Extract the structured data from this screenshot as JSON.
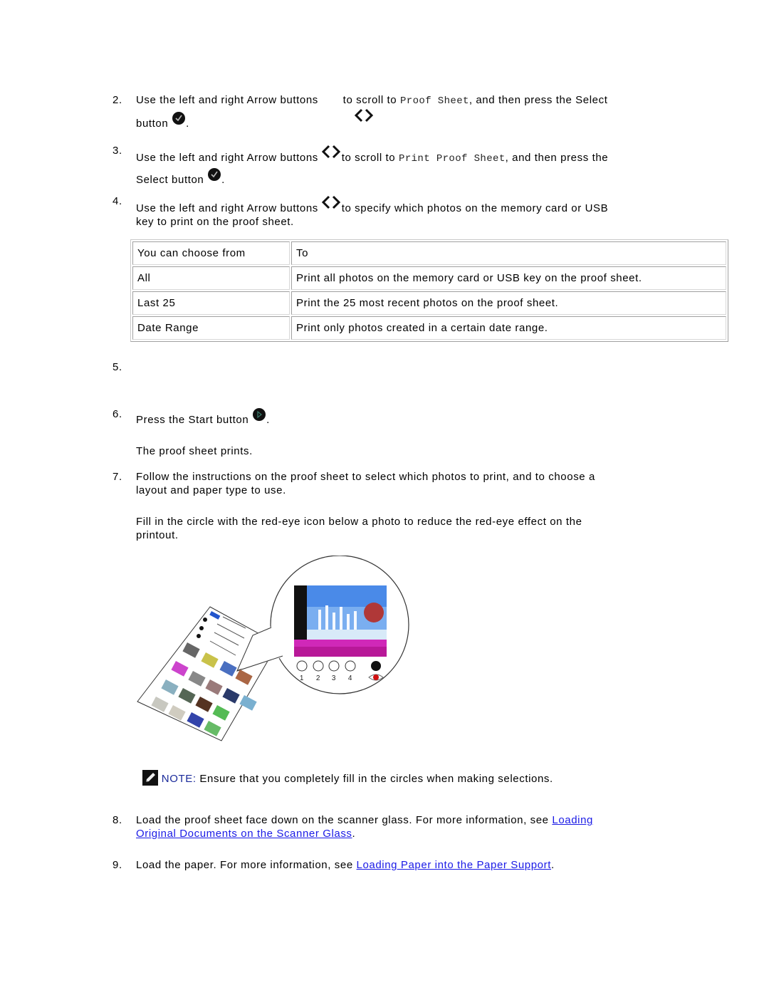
{
  "steps": [
    {
      "num": "2.",
      "pre": "Use the left and right Arrow buttons",
      "mid": " to scroll to ",
      "code": "Proof Sheet",
      "post": ", and then press the Select",
      "line2": "button",
      "end": "."
    },
    {
      "num": "3.",
      "pre": "Use the left and right Arrow buttons",
      "mid": "to scroll to ",
      "code": "Print Proof Sheet",
      "post": ", and then press the",
      "line2": "Select button",
      "end": "."
    },
    {
      "num": "4.",
      "pre": "Use the left and right Arrow buttons",
      "mid": "to specify which photos on the memory card or USB",
      "line2": "key to print on the proof sheet."
    },
    {
      "num": "5."
    },
    {
      "num": "6.",
      "pre": "Press the Start button",
      "end": ".",
      "sub": "The proof sheet prints."
    },
    {
      "num": "7.",
      "line1": "Follow the instructions on the proof sheet to select which photos to print, and to choose a",
      "line2": "layout and paper type to use.",
      "sub1": "Fill in the circle with the red-eye icon below a photo to reduce the red-eye effect on the",
      "sub2": "printout."
    },
    {
      "num": "8.",
      "pre": "Load the proof sheet face down on the scanner glass. For more information, see ",
      "link1": "Loading",
      "link2": "Original Documents on the Scanner Glass",
      "end": "."
    },
    {
      "num": "9.",
      "pre": "Load the paper. For more information, see ",
      "link": "Loading Paper into the Paper Support",
      "end": "."
    }
  ],
  "table": {
    "headers": [
      "You can choose from",
      "To"
    ],
    "rows": [
      [
        "All",
        "Print all photos on the memory card or USB key on the proof sheet."
      ],
      [
        "Last 25",
        "Print the 25 most recent photos on the proof sheet."
      ],
      [
        "Date Range",
        "Print only photos created in a certain date range."
      ]
    ]
  },
  "illustration": {
    "circle_labels": [
      "1",
      "2",
      "3",
      "4"
    ],
    "icons": [
      "proof-sheet",
      "magnified-photo",
      "selection-circles",
      "red-eye-icon"
    ]
  },
  "note": {
    "label": "NOTE:",
    "text": " Ensure that you completely fill in the circles when making selections."
  },
  "colors": {
    "link": "#1a1ae6",
    "note_label": "#1a2a9a"
  }
}
